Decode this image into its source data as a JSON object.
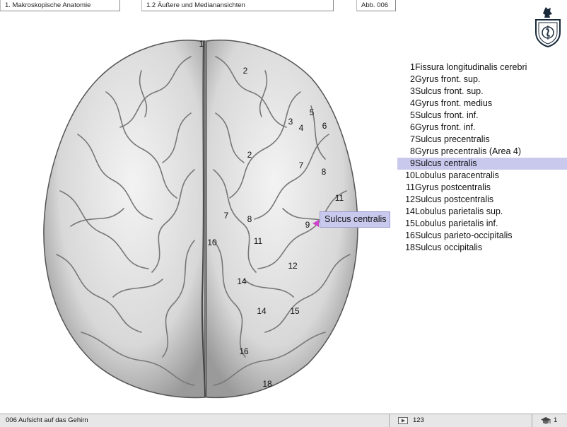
{
  "tabs": {
    "chapter": "1. Makroskopische Anatomie",
    "section": "1.2 Äußere und Medianansichten",
    "figure": "Abb. 006"
  },
  "brain_labels": [
    {
      "text": "1"
    },
    {
      "text": "2"
    },
    {
      "text": "5"
    },
    {
      "text": "3"
    },
    {
      "text": "4"
    },
    {
      "text": "6"
    },
    {
      "text": "2"
    },
    {
      "text": "7"
    },
    {
      "text": "8"
    },
    {
      "text": "11"
    },
    {
      "text": "7"
    },
    {
      "text": "8"
    },
    {
      "text": "9"
    },
    {
      "text": "10"
    },
    {
      "text": "11"
    },
    {
      "text": "12"
    },
    {
      "text": "14"
    },
    {
      "text": "14"
    },
    {
      "text": "15"
    },
    {
      "text": "16"
    },
    {
      "text": "18"
    }
  ],
  "legend": [
    {
      "num": "1",
      "text": "Fissura longitudinalis cerebri"
    },
    {
      "num": "2",
      "text": "Gyrus front. sup."
    },
    {
      "num": "3",
      "text": "Sulcus front. sup."
    },
    {
      "num": "4",
      "text": "Gyrus front. medius"
    },
    {
      "num": "5",
      "text": "Sulcus front. inf."
    },
    {
      "num": "6",
      "text": "Gyrus front. inf."
    },
    {
      "num": "7",
      "text": "Sulcus precentralis"
    },
    {
      "num": "8",
      "text": "Gyrus precentralis (Area 4)"
    },
    {
      "num": "9",
      "text": "Sulcus centralis",
      "highlighted": true
    },
    {
      "num": "10",
      "text": "Lobulus paracentralis"
    },
    {
      "num": "11",
      "text": "Gyrus postcentralis"
    },
    {
      "num": "12",
      "text": "Sulcus postcentralis"
    },
    {
      "num": "14",
      "text": "Lobulus parietalis sup."
    },
    {
      "num": "15",
      "text": "Lobulus parietalis inf."
    },
    {
      "num": "16",
      "text": "Sulcus parieto-occipitalis"
    },
    {
      "num": "18",
      "text": "Sulcus occipitalis"
    }
  ],
  "callout": {
    "text": "Sulcus centralis"
  },
  "highlight_color": "#c9c9ee",
  "pointer_color": "#cc44cc",
  "footer": {
    "caption": "006 Aufsicht auf das Gehirn",
    "page": "123",
    "volume": "1",
    "icons": [
      "page-icon",
      "mortarboard-icon"
    ]
  },
  "logo": {
    "icon": "knight-shield-logo"
  }
}
